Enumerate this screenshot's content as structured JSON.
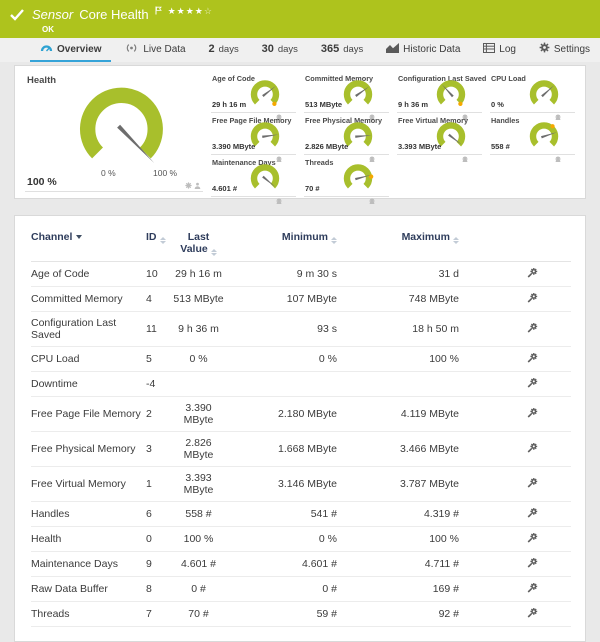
{
  "header": {
    "sensor_label": "Sensor",
    "title": "Core Health",
    "status": "OK",
    "stars_filled": "★★★★",
    "stars_empty": "☆"
  },
  "tabs": {
    "overview": "Overview",
    "live_data": "Live Data",
    "days2_num": "2",
    "days2_unit": "days",
    "days30_num": "30",
    "days30_unit": "days",
    "days365_num": "365",
    "days365_unit": "days",
    "historic": "Historic Data",
    "log": "Log",
    "settings": "Settings"
  },
  "gauges": {
    "main": {
      "label": "Health",
      "value": "100 %",
      "scale_min": "0 %",
      "scale_max": "100 %",
      "needle_deg": 46
    },
    "mini": [
      {
        "label": "Age of Code",
        "value": "29 h 16 m",
        "needle_deg": -38,
        "marker_deg": 45
      },
      {
        "label": "Committed Memory",
        "value": "513 MByte",
        "needle_deg": -35
      },
      {
        "label": "Configuration Last Saved",
        "value": "9 h 36 m",
        "needle_deg": -132,
        "marker_deg": 45
      },
      {
        "label": "CPU Load",
        "value": "0 %",
        "needle_deg": -42
      },
      {
        "label": "Free Page File Memory",
        "value": "3.390 MByte",
        "needle_deg": -8
      },
      {
        "label": "Free Physical Memory",
        "value": "2.826 MByte",
        "needle_deg": -5
      },
      {
        "label": "Free Virtual Memory",
        "value": "3.393 MByte",
        "needle_deg": 38
      },
      {
        "label": "Handles",
        "value": "558 #",
        "needle_deg": -18,
        "marker_deg": -50
      },
      {
        "label": "Maintenance Days",
        "value": "4.601 #",
        "needle_deg": 40
      },
      {
        "label": "Threads",
        "value": "70 #",
        "needle_deg": -15,
        "marker_deg": -8
      }
    ]
  },
  "table": {
    "columns": {
      "channel": "Channel",
      "id": "ID",
      "last_line1": "Last",
      "last_line2": "Value",
      "minimum": "Minimum",
      "maximum": "Maximum"
    },
    "rows": [
      {
        "channel": "Age of Code",
        "id": "10",
        "last": "29 h 16 m",
        "min": "9 m 30 s",
        "max": "31 d"
      },
      {
        "channel": "Committed Memory",
        "id": "4",
        "last": "513 MByte",
        "min": "107 MByte",
        "max": "748 MByte"
      },
      {
        "channel": "Configuration Last Saved",
        "id": "11",
        "last": "9 h 36 m",
        "min": "93 s",
        "max": "18 h 50 m"
      },
      {
        "channel": "CPU Load",
        "id": "5",
        "last": "0 %",
        "min": "0 %",
        "max": "100 %"
      },
      {
        "channel": "Downtime",
        "id": "-4",
        "last": "",
        "min": "",
        "max": ""
      },
      {
        "channel": "Free Page File Memory",
        "id": "2",
        "last": "3.390 MByte",
        "min": "2.180 MByte",
        "max": "4.119 MByte"
      },
      {
        "channel": "Free Physical Memory",
        "id": "3",
        "last": "2.826 MByte",
        "min": "1.668 MByte",
        "max": "3.466 MByte"
      },
      {
        "channel": "Free Virtual Memory",
        "id": "1",
        "last": "3.393 MByte",
        "min": "3.146 MByte",
        "max": "3.787 MByte"
      },
      {
        "channel": "Handles",
        "id": "6",
        "last": "558 #",
        "min": "541 #",
        "max": "4.319 #"
      },
      {
        "channel": "Health",
        "id": "0",
        "last": "100 %",
        "min": "0 %",
        "max": "100 %"
      },
      {
        "channel": "Maintenance Days",
        "id": "9",
        "last": "4.601 #",
        "min": "4.601 #",
        "max": "4.711 #"
      },
      {
        "channel": "Raw Data Buffer",
        "id": "8",
        "last": "0 #",
        "min": "0 #",
        "max": "169 #"
      },
      {
        "channel": "Threads",
        "id": "7",
        "last": "70 #",
        "min": "59 #",
        "max": "92 #"
      }
    ]
  },
  "colors": {
    "brand_green": "#aec31d",
    "gauge_green": "#a8bf2c",
    "accent_blue": "#35a3d8",
    "needle_gray": "#6d6d6d",
    "marker_orange": "#f5a800",
    "mini_icon_gray": "#bdbdbd"
  }
}
